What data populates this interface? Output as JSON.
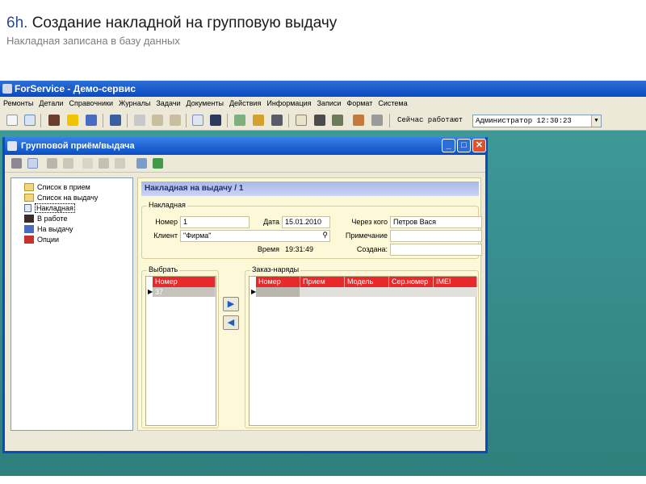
{
  "slide": {
    "title_num": "6h.",
    "title": "Создание накладной на групповую выдачу",
    "subtitle": "Накладная записана в базу данных"
  },
  "app": {
    "title": "ForService - Демо-сервис",
    "menu": [
      "Ремонты",
      "Детали",
      "Справочники",
      "Журналы",
      "Задачи",
      "Документы",
      "Действия",
      "Информация",
      "Записи",
      "Формат",
      "Система"
    ],
    "status_label": "Сейчас работают",
    "status_value": "Администратор 12:30:23"
  },
  "dialog": {
    "title": "Групповой приём/выдача",
    "tree": [
      "Список в прием",
      "Список на выдачу",
      "Накладная",
      "В работе",
      "На выдачу",
      "Опции"
    ],
    "header": "Накладная на выдачу / 1",
    "invoice_group": "Накладная",
    "fields": {
      "number_label": "Номер",
      "number_value": "1",
      "date_label": "Дата",
      "date_value": "15.01.2010",
      "via_label": "Через кого",
      "via_value": "Петров Вася",
      "client_label": "Клиент",
      "client_value": "\"Фирма\"",
      "note_label": "Примечание",
      "note_value": "",
      "time_label": "Время",
      "time_value": "19:31:49",
      "created_label": "Создана:",
      "created_value": ""
    },
    "select_group": "Выбрать",
    "select_grid": {
      "columns": [
        "Номер"
      ],
      "rows": [
        [
          "37"
        ]
      ]
    },
    "orders_group": "Заказ-наряды",
    "orders_grid": {
      "columns": [
        "Номер",
        "Прием",
        "Модель",
        "Сер.номер",
        "IMEI"
      ],
      "rows": [
        [
          "",
          "",
          "",
          "",
          ""
        ]
      ]
    },
    "arrow_right": "▶",
    "arrow_left": "◀"
  },
  "colors": {
    "grid_header": "#e8292c",
    "panel_bg": "#fcf8d8",
    "desktop": "#3a8c8a",
    "titlebar": "#0a4bc0"
  }
}
